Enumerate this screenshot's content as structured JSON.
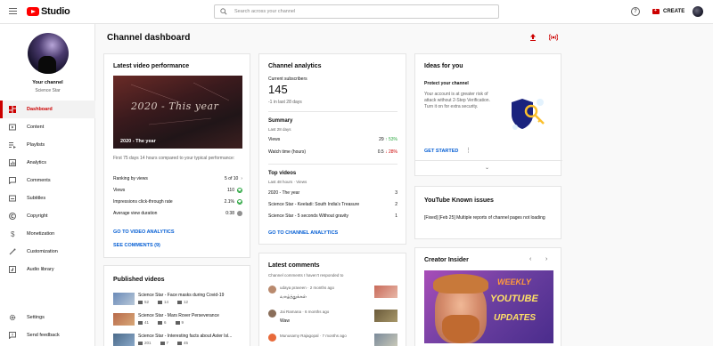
{
  "app": {
    "logo_text": "Studio"
  },
  "search": {
    "placeholder": "Search across your channel"
  },
  "header": {
    "create_label": "CREATE",
    "help_label": "?"
  },
  "sidebar": {
    "your_channel": "Your channel",
    "channel_name": "Science Star",
    "items": [
      {
        "label": "Dashboard",
        "icon": "dashboard-icon",
        "active": true
      },
      {
        "label": "Content",
        "icon": "content-icon"
      },
      {
        "label": "Playlists",
        "icon": "playlists-icon"
      },
      {
        "label": "Analytics",
        "icon": "analytics-icon"
      },
      {
        "label": "Comments",
        "icon": "comments-icon"
      },
      {
        "label": "Subtitles",
        "icon": "subtitles-icon"
      },
      {
        "label": "Copyright",
        "icon": "copyright-icon"
      },
      {
        "label": "Monetization",
        "icon": "monetization-icon"
      },
      {
        "label": "Customization",
        "icon": "customization-icon"
      },
      {
        "label": "Audio library",
        "icon": "audio-library-icon"
      }
    ],
    "bottom": [
      {
        "label": "Settings",
        "icon": "gear-icon"
      },
      {
        "label": "Send feedback",
        "icon": "feedback-icon"
      }
    ]
  },
  "page": {
    "title": "Channel dashboard"
  },
  "latest_video": {
    "title": "Latest video performance",
    "thumb_art_text": "2020 - This year",
    "video_title": "2020 - The year",
    "note": "First 75 days 14 hours compared to your typical performance:",
    "ranking_label": "Ranking by views",
    "ranking_value": "5 of 10",
    "ranking_arrow": "›",
    "metrics": [
      {
        "label": "Views",
        "value": "110"
      },
      {
        "label": "Impressions click-through rate",
        "value": "2.1%"
      },
      {
        "label": "Average view duration",
        "value": "0:38"
      }
    ],
    "link_analytics": "GO TO VIDEO ANALYTICS",
    "link_comments": "SEE COMMENTS (9)"
  },
  "published": {
    "title": "Published videos",
    "videos": [
      {
        "title": "Science Star - Face masks during Covid-19",
        "views": "52",
        "comments": "14",
        "likes": "12"
      },
      {
        "title": "Science Star - Mars Rover Perseverance",
        "views": "41",
        "comments": "6",
        "likes": "9"
      },
      {
        "title": "Science Star - Interesting facts about Aster Isl...",
        "views": "201",
        "comments": "7",
        "likes": "45"
      }
    ]
  },
  "analytics": {
    "title": "Channel analytics",
    "subs_label": "Current subscribers",
    "subs_value": "145",
    "subs_change": "-1 in last 28 days",
    "summary_title": "Summary",
    "summary_period": "Last 28 days",
    "summary_rows": [
      {
        "label": "Views",
        "value": "29",
        "change": "↑ 53%",
        "dir": "up"
      },
      {
        "label": "Watch time (hours)",
        "value": "0.5",
        "change": "↓ 28%",
        "dir": "down"
      }
    ],
    "top_title": "Top videos",
    "top_period": "Last 48 hours · Views",
    "top_rows": [
      {
        "label": "2020 - The year",
        "value": "3"
      },
      {
        "label": "Science Star - Keeladi: South India's Treasure",
        "value": "2"
      },
      {
        "label": "Science Star - 5 seconds Without gravity",
        "value": "1"
      }
    ],
    "link": "GO TO CHANNEL ANALYTICS"
  },
  "comments": {
    "title": "Latest comments",
    "subtitle": "Channel comments I haven't responded to",
    "items": [
      {
        "author": "udaya praveen",
        "time": "2 months ago",
        "text": "வாழ்த்துக்கள்",
        "avatar_color": "#b98a6e"
      },
      {
        "author": "Jai Ramana",
        "time": "6 months ago",
        "text": "Waw",
        "avatar_color": "#8a6e5a"
      },
      {
        "author": "Munusamy Rajagopal",
        "time": "7 months ago",
        "text": "",
        "avatar_color": "#e86a3a"
      }
    ]
  },
  "ideas": {
    "title": "Ideas for you",
    "prompt_title": "Protect your channel",
    "prompt_desc": "Your account is at greater risk of attack without 2-Step Verification. Turn it on for extra security.",
    "cta": "GET STARTED"
  },
  "known_issues": {
    "title": "YouTube Known issues",
    "text": "[Fixed] [Feb 25] Multiple reports of channel pages not loading"
  },
  "creator_insider": {
    "title": "Creator Insider",
    "thumb_words": [
      "WEEKLY",
      "YOUTUBE",
      "UPDATES"
    ]
  },
  "colors": {
    "brand": "#ff0000",
    "accent": "#cc0000",
    "link": "#065fd4",
    "positive": "#2ba640"
  }
}
